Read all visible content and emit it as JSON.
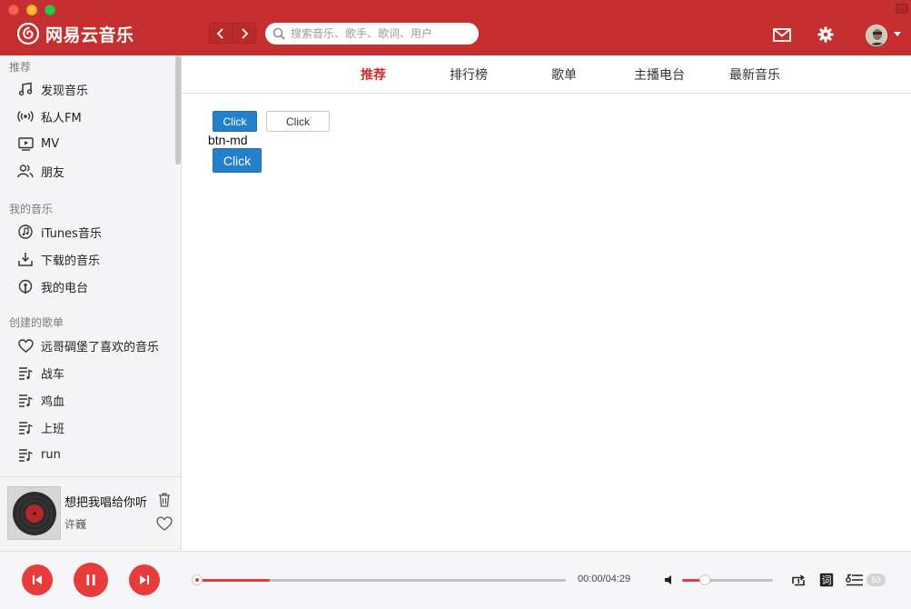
{
  "app": {
    "brand_name": "网易云音乐",
    "accent_color": "#c62f2f"
  },
  "header": {
    "search_placeholder": "搜索音乐、歌手、歌词、用户",
    "icons": [
      "back-icon",
      "forward-icon",
      "search-icon",
      "mail-icon",
      "gear-icon",
      "avatar"
    ]
  },
  "sidebar": {
    "sections": [
      {
        "title": "推荐",
        "items": [
          {
            "label": "发现音乐",
            "icon": "music-note-icon"
          },
          {
            "label": "私人FM",
            "icon": "radio-waves-icon"
          },
          {
            "label": "MV",
            "icon": "video-icon"
          },
          {
            "label": "朋友",
            "icon": "friends-icon"
          }
        ]
      },
      {
        "title": "我的音乐",
        "items": [
          {
            "label": "iTunes音乐",
            "icon": "itunes-icon"
          },
          {
            "label": "下载的音乐",
            "icon": "download-icon"
          },
          {
            "label": "我的电台",
            "icon": "podcast-icon"
          }
        ]
      },
      {
        "title": "创建的歌单",
        "items": [
          {
            "label": "远哥碉堡了喜欢的音乐",
            "icon": "heart-icon"
          },
          {
            "label": "战车",
            "icon": "playlist-icon"
          },
          {
            "label": "鸡血",
            "icon": "playlist-icon"
          },
          {
            "label": "上班",
            "icon": "playlist-icon"
          },
          {
            "label": "run",
            "icon": "playlist-icon"
          }
        ]
      }
    ],
    "now_playing": {
      "title": "想把我唱给你听",
      "artist": "许巍"
    }
  },
  "main": {
    "tabs": [
      {
        "label": "推荐",
        "active": true
      },
      {
        "label": "排行榜",
        "active": false
      },
      {
        "label": "歌单",
        "active": false
      },
      {
        "label": "主播电台",
        "active": false
      },
      {
        "label": "最新音乐",
        "active": false
      }
    ],
    "buttons": {
      "primary_sm_label": "Click",
      "default_sm_label": "Click",
      "md_caption": "btn-md",
      "primary_md_label": "Click"
    }
  },
  "player": {
    "time_display": "00:00/04:29",
    "progress_fraction": 0.2,
    "volume_fraction": 0.25,
    "lyrics_label": "词",
    "playlist_count": "50"
  }
}
